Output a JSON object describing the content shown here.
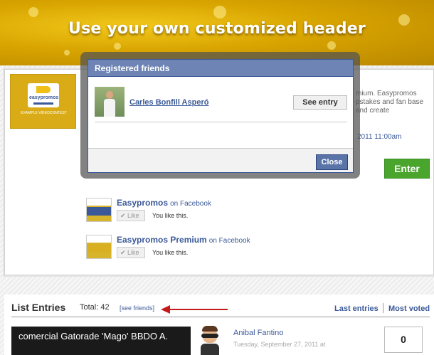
{
  "header": {
    "title": "Use your own customized header"
  },
  "promo": {
    "logo_brand": "easypromos",
    "logo_subtitle": "EXAMPLE VIDEOCONTEST",
    "right_text": "mium. Easypromos pstakes and fan base and create",
    "date": "2011 11:00am",
    "enter_label": "Enter"
  },
  "dialog": {
    "title": "Registered friends",
    "friend_name": "Carles Bonfill Asperó",
    "see_entry_label": "See entry",
    "close_label": "Close"
  },
  "facebook_likes": [
    {
      "name": "Easypromos",
      "suffix": "on Facebook",
      "like_label": "Like",
      "status": "You like this."
    },
    {
      "name": "Easypromos Premium",
      "suffix": "on Facebook",
      "like_label": "Like",
      "status": "You like this."
    }
  ],
  "list": {
    "title": "List Entries",
    "total": "Total: 42",
    "see_friends": "[see friends]",
    "last_entries": "Last entries",
    "most_voted": "Most voted"
  },
  "entry": {
    "video_title": "comercial Gatorade 'Mago' BBDO A.",
    "author": "Anibal Fantino",
    "date": "Tuesday, September 27, 2011 at",
    "votes": "0"
  },
  "colors": {
    "facebook_blue": "#3b5998",
    "enter_green": "#4aa52d",
    "banner_gold": "#d8a400",
    "arrow_red": "#c41a1a"
  }
}
